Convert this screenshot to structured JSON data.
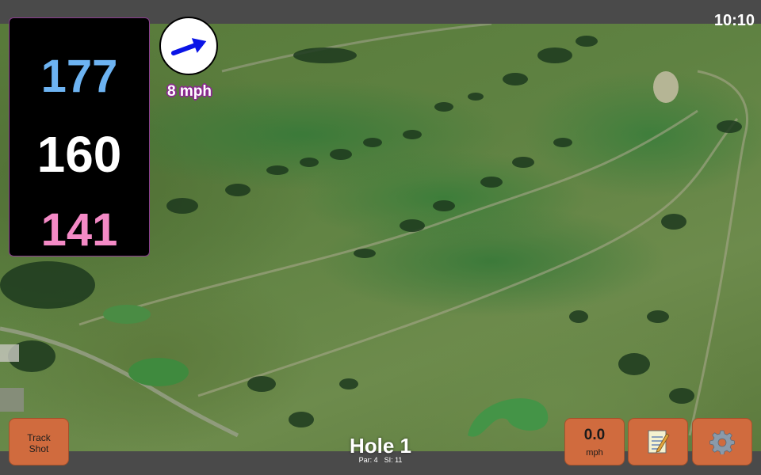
{
  "status": {
    "time": "10:10"
  },
  "yardage": {
    "back": "177",
    "center": "160",
    "front": "141"
  },
  "wind": {
    "speed_label": "8 mph",
    "icon": "wind-arrow-icon",
    "arrow_color": "#0a14e6"
  },
  "hole": {
    "title": "Hole 1",
    "par_label": "Par: 4",
    "si_label": "SI: 11"
  },
  "buttons": {
    "track_line1": "Track",
    "track_line2": "Shot",
    "speed_value": "0.0",
    "speed_unit": "mph",
    "notes_icon": "notepad-icon",
    "settings_icon": "gear-icon"
  },
  "colors": {
    "back": "#6db3f2",
    "center": "#ffffff",
    "front": "#f48ac6",
    "button": "#d06b3e",
    "panel_border": "#8a3b8f"
  }
}
